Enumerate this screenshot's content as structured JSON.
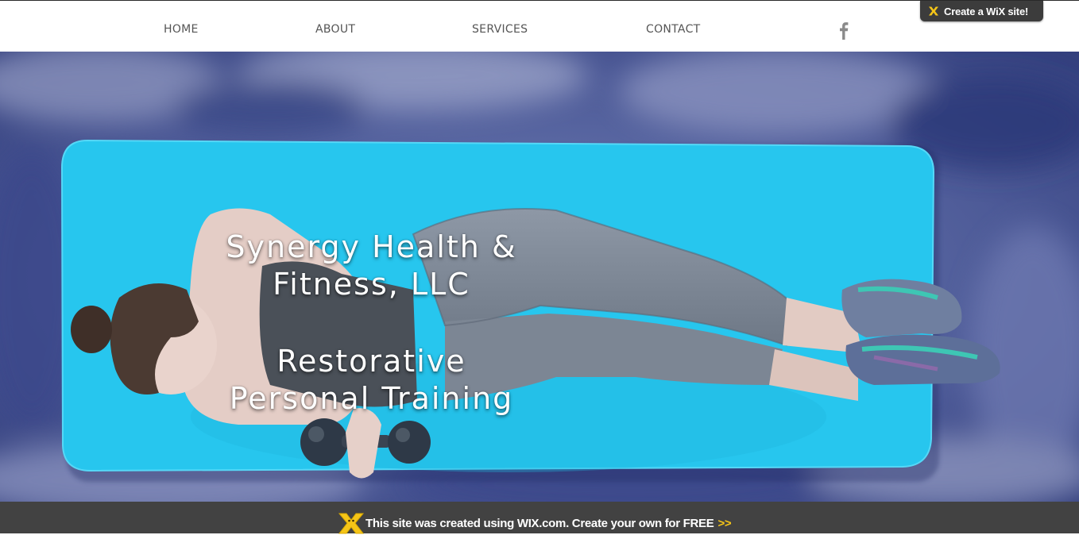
{
  "nav": {
    "items": [
      {
        "label": "HOME"
      },
      {
        "label": "ABOUT"
      },
      {
        "label": "SERVICES"
      },
      {
        "label": "CONTACT"
      }
    ],
    "social_icon": "facebook-icon"
  },
  "wix_badge": {
    "label": "Create a WiX site!",
    "icon": "wix-x-icon"
  },
  "hero": {
    "title_line1": "Synergy Health &",
    "title_line2": "Fitness, LLC",
    "subtitle_line1": "Restorative",
    "subtitle_line2": "Personal Training",
    "image": "woman-exercising-on-yoga-mat-photo"
  },
  "footer_banner": {
    "message": "This site was created using WIX.com. Create your own for FREE",
    "arrows": ">>",
    "icon": "wix-mascot-icon"
  },
  "colors": {
    "nav_text": "#555555",
    "banner_bg": "#424242",
    "accent_yellow": "#f5c518",
    "mat_blue": "#27c6ee"
  }
}
